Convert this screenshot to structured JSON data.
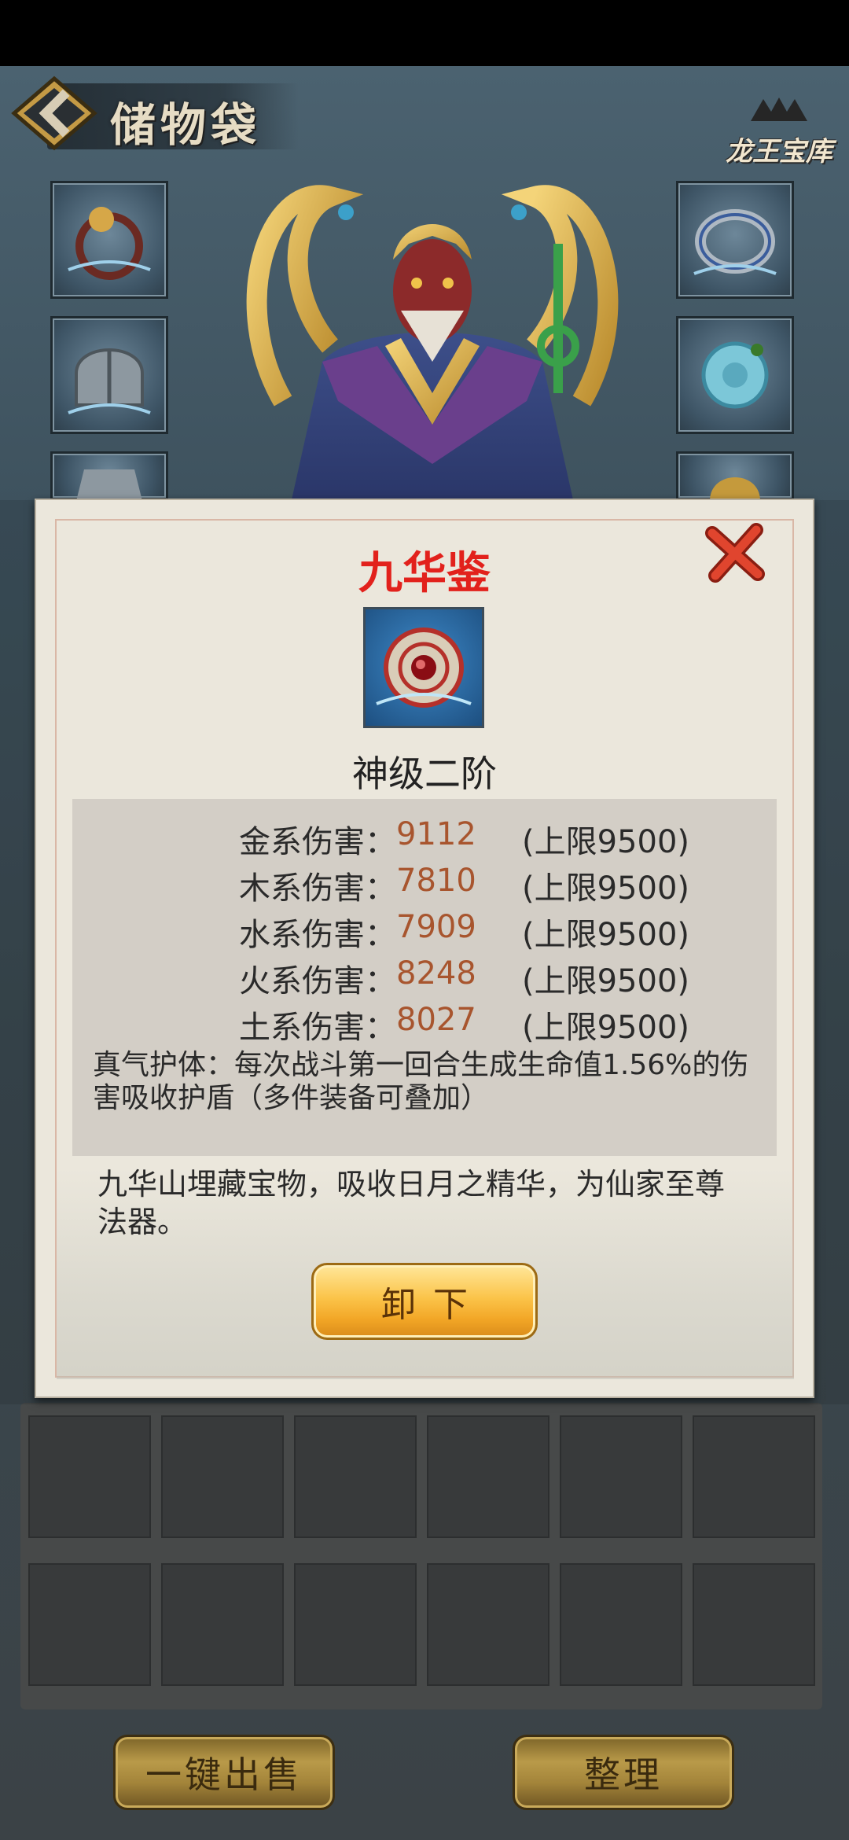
{
  "header": {
    "title": "储物袋",
    "treasury_label": "龙王宝库"
  },
  "icons": {
    "back": "back-arrow-icon",
    "close": "close-x-icon",
    "treasury": "dragon-king-emblem-icon"
  },
  "colors": {
    "item_name": "#e2211c",
    "stat_value": "#a8552e",
    "unequip_button": "#f7b733"
  },
  "item": {
    "name": "九华鉴",
    "grade": "神级二阶",
    "stats": [
      {
        "label": "金系伤害：",
        "value": "9112",
        "cap": "(上限9500)"
      },
      {
        "label": "木系伤害：",
        "value": "7810",
        "cap": "(上限9500)"
      },
      {
        "label": "水系伤害：",
        "value": "7909",
        "cap": "(上限9500)"
      },
      {
        "label": "火系伤害：",
        "value": "8248",
        "cap": "(上限9500)"
      },
      {
        "label": "土系伤害：",
        "value": "8027",
        "cap": "(上限9500)"
      }
    ],
    "skill": "真气护体：每次战斗第一回合生成生命值1.56%的伤害吸收护盾（多件装备可叠加）",
    "description": "九华山埋藏宝物，吸收日月之精华，为仙家至尊法器。",
    "unequip_label": "卸下"
  },
  "footer": {
    "sell_all_label": "一键出售",
    "sort_label": "整理"
  }
}
